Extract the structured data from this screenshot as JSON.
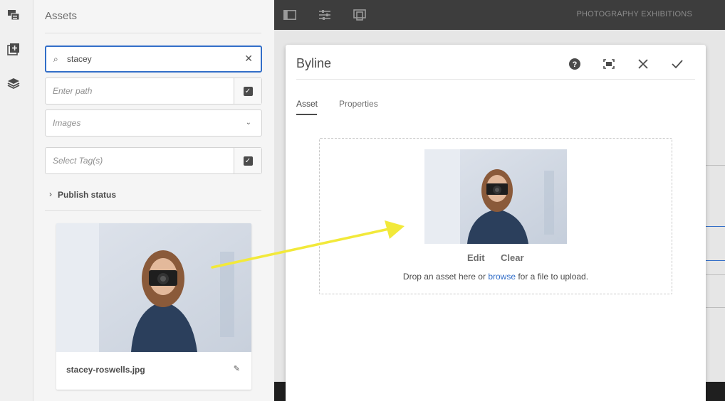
{
  "rail": {
    "icons": [
      "assets-filter-icon",
      "add-component-icon",
      "layers-icon"
    ]
  },
  "assets_panel": {
    "title": "Assets",
    "search": {
      "value": "stacey"
    },
    "path": {
      "placeholder": "Enter path"
    },
    "type_select": {
      "value": "Images"
    },
    "tags": {
      "placeholder": "Select Tag(s)"
    },
    "publish_status": "Publish status",
    "asset_card": {
      "filename": "stacey-roswells.jpg"
    }
  },
  "topbar": {
    "icons": [
      "page-properties-icon",
      "adjust-icon",
      "emulator-icon"
    ],
    "page_title": "PHOTOGRAPHY EXHIBITIONS"
  },
  "dialog": {
    "title": "Byline",
    "tabs": [
      {
        "label": "Asset",
        "active": true
      },
      {
        "label": "Properties",
        "active": false
      }
    ],
    "edit_label": "Edit",
    "clear_label": "Clear",
    "hint_before": "Drop an asset here or ",
    "hint_link": "browse",
    "hint_after": " for a file to upload."
  },
  "colors": {
    "accent": "#326ec8",
    "annotation_arrow": "#f2e93a",
    "topbar": "#3d3d3d"
  }
}
